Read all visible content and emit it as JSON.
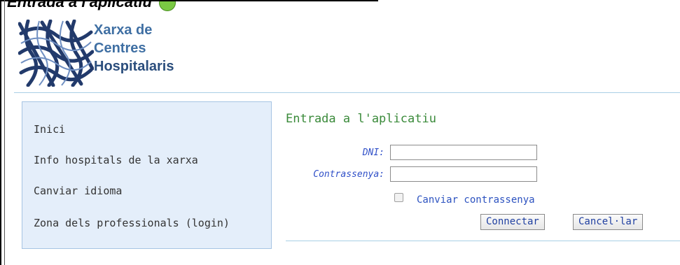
{
  "caption": {
    "text": "Entrada a l'aplicatiu"
  },
  "logo": {
    "lines": [
      "Xarxa de",
      "Centres",
      "Hospitalaris"
    ]
  },
  "sidebar": {
    "items": [
      {
        "label": "Inici"
      },
      {
        "label": "Info hospitals de la xarxa"
      },
      {
        "label": "Canviar idioma"
      },
      {
        "label": "Zona dels professionals (login)"
      }
    ]
  },
  "login": {
    "title": "Entrada a l'aplicatiu",
    "dni_label": "DNI:",
    "dni_value": "",
    "password_label": "Contrassenya:",
    "password_value": "",
    "change_password_label": "Canviar contrassenya",
    "change_password_checked": false,
    "connect_label": "Connectar",
    "cancel_label": "Cancel·lar"
  },
  "colors": {
    "sidebar_bg": "#e4eefa",
    "title_green": "#3a8a3a",
    "label_blue": "#3050c8",
    "divider": "#a9cfe6",
    "logo_blue": "#3f6fa3"
  }
}
